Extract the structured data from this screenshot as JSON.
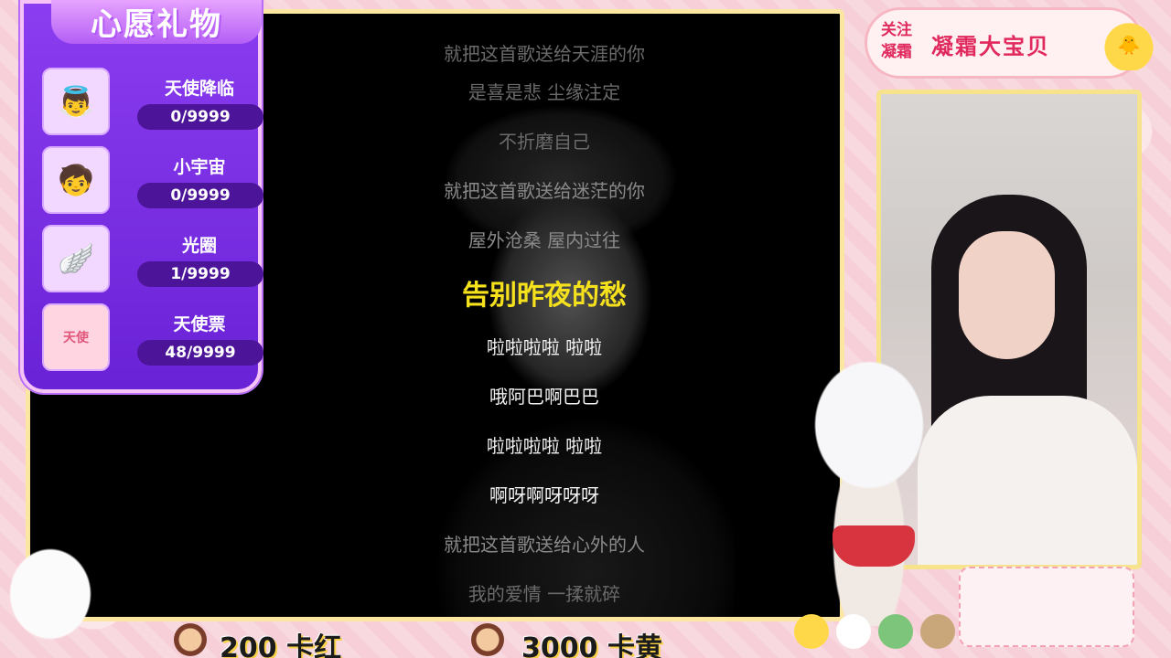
{
  "wish_panel": {
    "title": "心愿礼物",
    "gifts": [
      {
        "name": "天使降临",
        "count": "0/9999",
        "icon": "angel-avatar-icon"
      },
      {
        "name": "小宇宙",
        "count": "0/9999",
        "icon": "cosmos-avatar-icon"
      },
      {
        "name": "光圈",
        "count": "1/9999",
        "icon": "halo-wings-icon"
      },
      {
        "name": "天使票",
        "count": "48/9999",
        "icon": "angel-ticket-icon",
        "thumb_text": "天使"
      }
    ]
  },
  "lyrics": [
    {
      "text": "就把这首歌送给天涯的你",
      "style": "dim"
    },
    {
      "text": "是喜是悲 尘缘注定",
      "style": "dim"
    },
    {
      "text": "不折磨自己",
      "style": "dim"
    },
    {
      "text": "就把这首歌送给迷茫的你",
      "style": "normal"
    },
    {
      "text": "屋外沧桑 屋内过往",
      "style": "normal"
    },
    {
      "text": "告别昨夜的愁",
      "style": "current"
    },
    {
      "text": "啦啦啦啦 啦啦",
      "style": "bright"
    },
    {
      "text": "哦阿巴啊巴巴",
      "style": "bright"
    },
    {
      "text": "啦啦啦啦 啦啦",
      "style": "bright"
    },
    {
      "text": "啊呀啊呀呀呀",
      "style": "bright"
    },
    {
      "text": "就把这首歌送给心外的人",
      "style": "normal"
    },
    {
      "text": "我的爱情 一揉就碎",
      "style": "dim"
    }
  ],
  "streamer": {
    "follow_tag": "关注凝霜",
    "name": "凝霜大宝贝"
  },
  "bottom": {
    "price1": "200 卡红",
    "price2": "3000 卡黄"
  },
  "colors": {
    "panel_purple": "#7a2ee6",
    "lyric_highlight": "#f6e21c",
    "accent_pink": "#e02a5d"
  }
}
